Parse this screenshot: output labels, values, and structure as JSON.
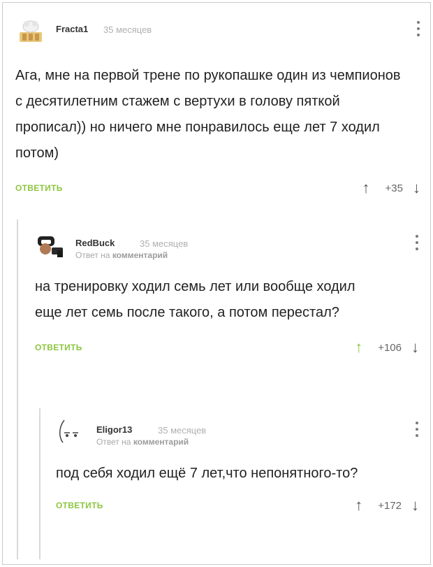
{
  "comments": [
    {
      "author": "Fracta1",
      "time": "35 месяцев",
      "text": "Ага, мне на первой трене по рукопашке один из чемпионов с десятилетним стажем с вертухи в голову пяткой прописал)) но ничего мне понравилось еще лет 7 ходил потом)",
      "reply_label": "ОТВЕТИТЬ",
      "score": "+35",
      "upvoted": false
    },
    {
      "author": "RedBuck",
      "time": "35 месяцев",
      "reply_to_prefix": "Ответ на",
      "reply_to_link": "комментарий",
      "text": "на тренировку ходил семь лет или вообще ходил еще лет семь после такого, а потом перестал?",
      "reply_label": "ОТВЕТИТЬ",
      "score": "+106",
      "upvoted": true
    },
    {
      "author": "Eligor13",
      "time": "35 месяцев",
      "reply_to_prefix": "Ответ на",
      "reply_to_link": "комментарий",
      "text": "под себя ходил ещё 7 лет,что непонятного-то?",
      "reply_label": "ОТВЕТИТЬ",
      "score": "+172",
      "upvoted": false
    }
  ],
  "colors": {
    "accent": "#8dc63f",
    "muted": "#b0b0b0",
    "text": "#222222"
  },
  "icons": {
    "up": "arrow-up-icon",
    "down": "arrow-down-icon",
    "menu": "more-vertical-icon"
  }
}
